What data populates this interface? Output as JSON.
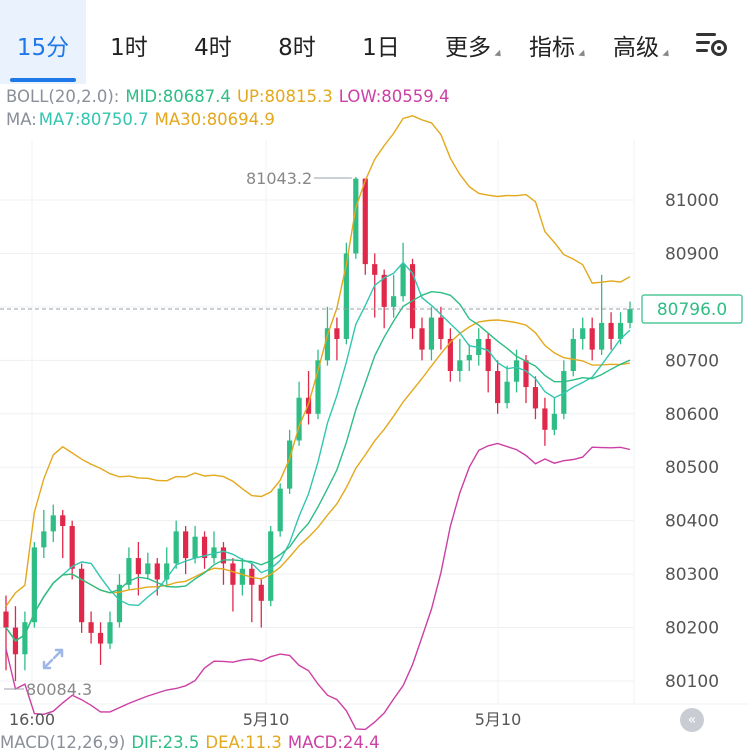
{
  "tabs": [
    {
      "label": "15分",
      "active": true
    },
    {
      "label": "1时"
    },
    {
      "label": "4时"
    },
    {
      "label": "8时"
    },
    {
      "label": "1日"
    },
    {
      "label": "更多",
      "dropdown": true
    },
    {
      "label": "指标",
      "dropdown": true
    },
    {
      "label": "高级",
      "dropdown": true
    }
  ],
  "settings_icon": "chart-settings-icon",
  "boll": {
    "label": "BOLL(20,2.0):",
    "mid": "MID:80687.4",
    "up": "UP:80815.3",
    "low": "LOW:80559.4"
  },
  "ma": {
    "label": "MA:",
    "ma7": "MA7:80750.7",
    "ma30": "MA30:80694.9"
  },
  "price_axis": {
    "ticks": [
      "81000",
      "80900",
      "80800",
      "80700",
      "80600",
      "80500",
      "80400",
      "80300",
      "80200",
      "80100"
    ],
    "current_price": "80796.0"
  },
  "annotations": {
    "high": "81043.2",
    "low": "80084.3"
  },
  "time_axis": {
    "labels": [
      "16:00",
      "5月10",
      "5月10"
    ]
  },
  "macd": {
    "label": "MACD(12,26,9)",
    "dif": "DIF:23.5",
    "dea": "DEA:11.3",
    "macd": "MACD:24.4"
  },
  "colors": {
    "up": "#2ebd85",
    "down": "#e0294a",
    "accent": "#1f78e8",
    "mid": "#e3a81c",
    "upper": "#e3a81c",
    "lower": "#cc3fa4",
    "ma7": "#32c6b0",
    "ma30": "#e3a81c",
    "boll_label": "#8a8f99",
    "price_box": "#2ebd85"
  },
  "chart_data": {
    "type": "candlestick",
    "x_labels": [
      "16:00",
      "5月10",
      "5月10"
    ],
    "y_ticks": [
      80100,
      80200,
      80300,
      80400,
      80500,
      80600,
      80700,
      80800,
      80900,
      81000
    ],
    "last_price": 80796.0,
    "high_mark": 81043.2,
    "low_mark": 80084.3,
    "candles": [
      [
        80230,
        80200,
        80260,
        80120,
        "d"
      ],
      [
        80200,
        80150,
        80240,
        80100,
        "d"
      ],
      [
        80150,
        80210,
        80230,
        80120,
        "u"
      ],
      [
        80210,
        80350,
        80360,
        80200,
        "u"
      ],
      [
        80350,
        80380,
        80420,
        80330,
        "u"
      ],
      [
        80380,
        80410,
        80430,
        80360,
        "u"
      ],
      [
        80410,
        80390,
        80420,
        80330,
        "d"
      ],
      [
        80390,
        80310,
        80400,
        80290,
        "d"
      ],
      [
        80310,
        80210,
        80320,
        80190,
        "d"
      ],
      [
        80210,
        80190,
        80230,
        80170,
        "d"
      ],
      [
        80190,
        80170,
        80210,
        80130,
        "d"
      ],
      [
        80170,
        80210,
        80230,
        80160,
        "u"
      ],
      [
        80210,
        80280,
        80300,
        80200,
        "u"
      ],
      [
        80280,
        80330,
        80350,
        80270,
        "u"
      ],
      [
        80330,
        80300,
        80360,
        80260,
        "d"
      ],
      [
        80300,
        80320,
        80340,
        80290,
        "u"
      ],
      [
        80320,
        80290,
        80330,
        80260,
        "d"
      ],
      [
        80290,
        80320,
        80350,
        80280,
        "u"
      ],
      [
        80320,
        80380,
        80400,
        80310,
        "u"
      ],
      [
        80380,
        80330,
        80390,
        80300,
        "d"
      ],
      [
        80330,
        80370,
        80390,
        80320,
        "u"
      ],
      [
        80370,
        80330,
        80380,
        80310,
        "d"
      ],
      [
        80330,
        80350,
        80380,
        80320,
        "u"
      ],
      [
        80350,
        80320,
        80360,
        80280,
        "d"
      ],
      [
        80320,
        80280,
        80330,
        80230,
        "d"
      ],
      [
        80280,
        80310,
        80330,
        80260,
        "u"
      ],
      [
        80310,
        80280,
        80320,
        80210,
        "d"
      ],
      [
        80280,
        80250,
        80290,
        80200,
        "d"
      ],
      [
        80250,
        80380,
        80390,
        80240,
        "u"
      ],
      [
        80380,
        80460,
        80470,
        80370,
        "u"
      ],
      [
        80460,
        80550,
        80570,
        80450,
        "u"
      ],
      [
        80550,
        80630,
        80660,
        80540,
        "u"
      ],
      [
        80630,
        80600,
        80680,
        80580,
        "d"
      ],
      [
        80600,
        80700,
        80720,
        80590,
        "u"
      ],
      [
        80700,
        80760,
        80800,
        80690,
        "u"
      ],
      [
        80760,
        80740,
        80780,
        80700,
        "d"
      ],
      [
        80740,
        80900,
        80920,
        80730,
        "u"
      ],
      [
        80900,
        81040,
        81043,
        80890,
        "u"
      ],
      [
        81040,
        80880,
        81040,
        80860,
        "d"
      ],
      [
        80880,
        80860,
        80900,
        80780,
        "d"
      ],
      [
        80860,
        80800,
        80870,
        80760,
        "d"
      ],
      [
        80800,
        80820,
        80860,
        80780,
        "u"
      ],
      [
        80820,
        80880,
        80920,
        80810,
        "u"
      ],
      [
        80880,
        80760,
        80890,
        80740,
        "d"
      ],
      [
        80760,
        80720,
        80780,
        80700,
        "d"
      ],
      [
        80720,
        80780,
        80800,
        80700,
        "u"
      ],
      [
        80780,
        80740,
        80800,
        80720,
        "d"
      ],
      [
        80740,
        80680,
        80760,
        80660,
        "d"
      ],
      [
        80680,
        80700,
        80740,
        80660,
        "u"
      ],
      [
        80700,
        80710,
        80730,
        80680,
        "u"
      ],
      [
        80710,
        80740,
        80760,
        80690,
        "u"
      ],
      [
        80740,
        80680,
        80750,
        80640,
        "d"
      ],
      [
        80680,
        80620,
        80700,
        80600,
        "d"
      ],
      [
        80620,
        80660,
        80690,
        80610,
        "u"
      ],
      [
        80660,
        80700,
        80720,
        80640,
        "u"
      ],
      [
        80700,
        80650,
        80710,
        80620,
        "d"
      ],
      [
        80650,
        80610,
        80670,
        80590,
        "d"
      ],
      [
        80610,
        80570,
        80630,
        80540,
        "d"
      ],
      [
        80570,
        80600,
        80630,
        80560,
        "u"
      ],
      [
        80600,
        80680,
        80700,
        80590,
        "u"
      ],
      [
        80680,
        80740,
        80760,
        80670,
        "u"
      ],
      [
        80740,
        80760,
        80780,
        80720,
        "u"
      ],
      [
        80760,
        80720,
        80780,
        80700,
        "d"
      ],
      [
        80720,
        80770,
        80860,
        80710,
        "u"
      ],
      [
        80770,
        80740,
        80790,
        80720,
        "d"
      ],
      [
        80740,
        80770,
        80790,
        80730,
        "u"
      ],
      [
        80770,
        80796,
        80810,
        80760,
        "u"
      ]
    ]
  }
}
